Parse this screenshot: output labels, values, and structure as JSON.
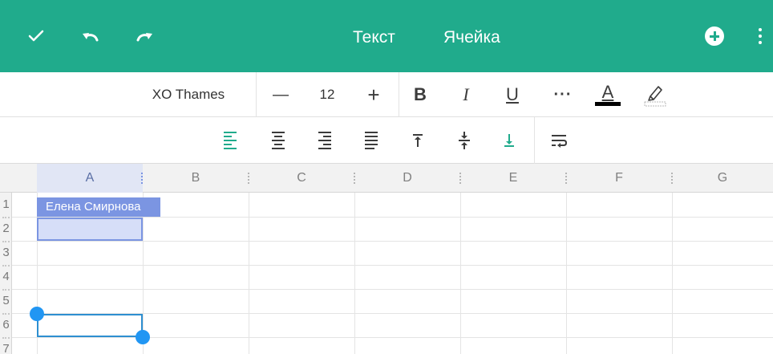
{
  "toolbar": {
    "tabs": [
      {
        "label": "Текст"
      },
      {
        "label": "Ячейка"
      }
    ],
    "colors": {
      "background": "#20ab8c",
      "icon": "#ffffff"
    },
    "icons": {
      "confirm": "check-icon",
      "undo": "undo-icon",
      "redo": "redo-icon",
      "add": "add-circle-icon",
      "more": "more-vertical-icon"
    }
  },
  "format_row_1": {
    "font_name": "XO Thames",
    "font_size": "12",
    "decrease_label": "—",
    "increase_label": "+",
    "bold_label": "B",
    "italic_label": "I",
    "underline_label": "U",
    "more_label": "···",
    "font_color_label": "A",
    "font_color": "#000000",
    "highlight_icon": "highlighter-icon"
  },
  "format_row_2": {
    "active_horizontal_alignment": "left",
    "active_vertical_alignment": "bottom",
    "accent_color": "#20ab8c",
    "icons": [
      "align-left-icon",
      "align-center-icon",
      "align-right-icon",
      "align-justify-icon",
      "valign-top-icon",
      "valign-middle-icon",
      "valign-bottom-icon",
      "wrap-text-icon"
    ]
  },
  "sheet": {
    "columns": [
      "A",
      "B",
      "C",
      "D",
      "E",
      "F",
      "G"
    ],
    "rows": [
      "1",
      "2",
      "3",
      "4",
      "5",
      "6",
      "7"
    ],
    "cells": {
      "A1": "Елена Смирнова"
    },
    "selected_column": "A",
    "selection_color": "#2e8fd0",
    "highlight_color": "#7b95e2"
  }
}
